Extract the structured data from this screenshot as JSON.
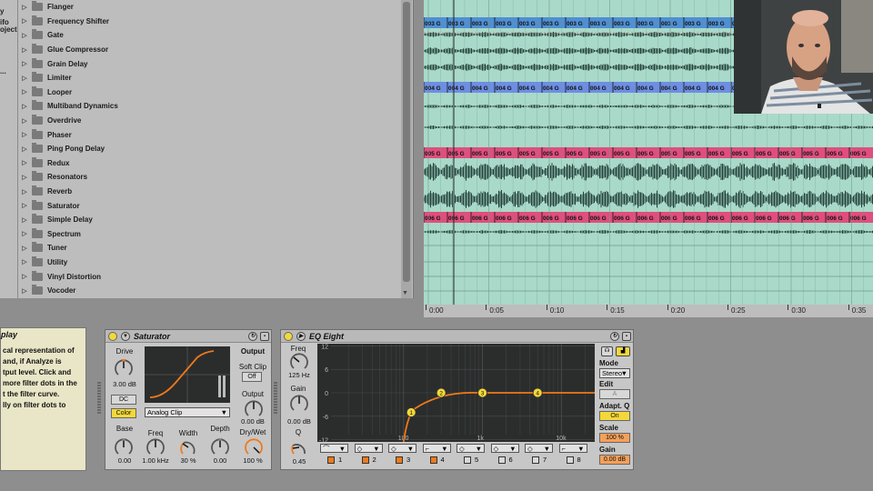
{
  "browser": {
    "side_labels": [
      "y",
      "ifo",
      "oject",
      "..."
    ],
    "devices": [
      "Flanger",
      "Frequency Shifter",
      "Gate",
      "Glue Compressor",
      "Grain Delay",
      "Limiter",
      "Looper",
      "Multiband Dynamics",
      "Overdrive",
      "Phaser",
      "Ping Pong Delay",
      "Redux",
      "Resonators",
      "Reverb",
      "Saturator",
      "Simple Delay",
      "Spectrum",
      "Tuner",
      "Utility",
      "Vinyl Distortion",
      "Vocoder"
    ]
  },
  "arrangement": {
    "clips": [
      {
        "label": "003 G",
        "color": "#4f8fd3"
      },
      {
        "label": "004 G",
        "color": "#6e8ee4"
      },
      {
        "label": "005 G",
        "color": "#e04e7e"
      },
      {
        "label": "006 G",
        "color": "#e04e7e"
      }
    ],
    "timeline": [
      "0:00",
      "0:05",
      "0:10",
      "0:15",
      "0:20",
      "0:25",
      "0:30",
      "0:35"
    ]
  },
  "info": {
    "title": "play",
    "lines": [
      "cal representation of",
      "and, if Analyze is",
      "tput level. Click and",
      "more filter dots in the",
      "t the filter curve.",
      "lly on filter dots to"
    ]
  },
  "saturator": {
    "title": "Saturator",
    "drive_label": "Drive",
    "drive_value": "3.00 dB",
    "dc_label": "DC",
    "color_label": "Color",
    "type_value": "Analog Clip",
    "output_header": "Output",
    "soft_clip_label": "Soft Clip",
    "soft_clip_value": "Off",
    "output_label": "Output",
    "output_value": "0.00 dB",
    "drywet_label": "Dry/Wet",
    "drywet_value": "100 %",
    "base_label": "Base",
    "base_value": "0.00",
    "freq_label": "Freq",
    "freq_value": "1.00 kHz",
    "width_label": "Width",
    "width_value": "30 %",
    "depth_label": "Depth",
    "depth_value": "0.00"
  },
  "eq": {
    "title": "EQ Eight",
    "freq_label": "Freq",
    "freq_value": "125 Hz",
    "gain_label": "Gain",
    "gain_value": "0.00 dB",
    "q_label": "Q",
    "q_value": "0.45",
    "db_ticks": [
      "12",
      "6",
      "0",
      "-6",
      "-12"
    ],
    "hz_ticks": [
      "100",
      "1k",
      "10k"
    ],
    "bands": [
      "1",
      "2",
      "3",
      "4",
      "5",
      "6",
      "7",
      "8"
    ],
    "mode_label": "Mode",
    "mode_value": "Stereo",
    "edit_label": "Edit",
    "edit_value": "A",
    "adaptq_label": "Adapt. Q",
    "adaptq_value": "On",
    "scale_label": "Scale",
    "scale_value": "100 %",
    "gain2_label": "Gain",
    "gain2_value": "0.00 dB"
  },
  "colors": {
    "accent": "#f4d83a",
    "orange": "#f07a1a",
    "eq_bg": "#2b2d2d",
    "arr_bg": "#a9d9c9"
  }
}
